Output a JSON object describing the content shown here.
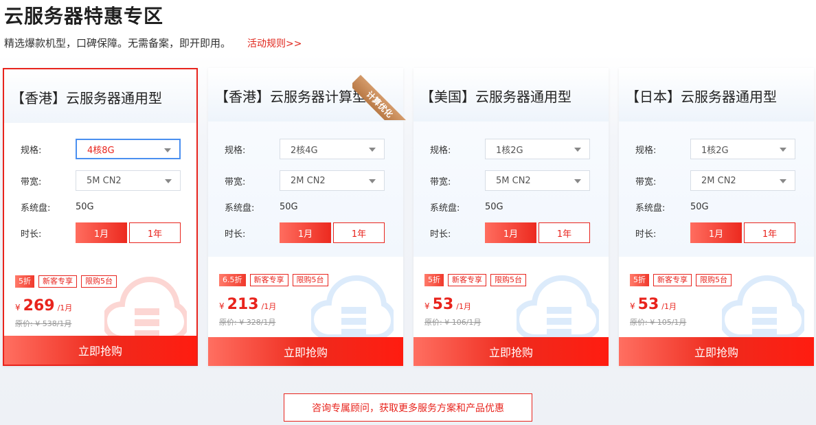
{
  "header": {
    "title": "云服务器特惠专区",
    "subtitle": "精选爆款机型，口碑保障。无需备案，即开即用。",
    "rules_link": "活动规则>>"
  },
  "colors": {
    "accent": "#e8231c",
    "focus_blue": "#4a8ff0",
    "corner_badge": "#c1844f"
  },
  "spec_labels": {
    "config": "规格:",
    "bandwidth": "带宽:",
    "disk": "系统盘:",
    "duration": "时长:"
  },
  "buy_label": "立即抢购",
  "cards": [
    {
      "title": "【香港】云服务器通用型",
      "config": "4核8G",
      "bandwidth": "5M CN2",
      "disk": "50G",
      "duration_options": [
        "1月",
        "1年"
      ],
      "discount": "5折",
      "tags": [
        "新客专享",
        "限购5台"
      ],
      "currency": "¥",
      "price": "269",
      "price_unit": "/1月",
      "original": "原价: ¥ 538/1月"
    },
    {
      "title": "【香港】云服务器计算型",
      "corner_badge": "计算优化",
      "config": "2核4G",
      "bandwidth": "2M CN2",
      "disk": "50G",
      "duration_options": [
        "1月",
        "1年"
      ],
      "discount": "6.5折",
      "tags": [
        "新客专享",
        "限购5台"
      ],
      "currency": "¥",
      "price": "213",
      "price_unit": "/1月",
      "original": "原价: ¥ 328/1月"
    },
    {
      "title": "【美国】云服务器通用型",
      "config": "1核2G",
      "bandwidth": "5M CN2",
      "disk": "50G",
      "duration_options": [
        "1月",
        "1年"
      ],
      "discount": "5折",
      "tags": [
        "新客专享",
        "限购5台"
      ],
      "currency": "¥",
      "price": "53",
      "price_unit": "/1月",
      "original": "原价: ¥ 106/1月"
    },
    {
      "title": "【日本】云服务器通用型",
      "config": "1核2G",
      "bandwidth": "2M CN2",
      "disk": "50G",
      "duration_options": [
        "1月",
        "1年"
      ],
      "discount": "5折",
      "tags": [
        "新客专享",
        "限购5台"
      ],
      "currency": "¥",
      "price": "53",
      "price_unit": "/1月",
      "original": "原价: ¥ 105/1月"
    }
  ],
  "consult_button": "咨询专属顾问，获取更多服务方案和产品优惠"
}
